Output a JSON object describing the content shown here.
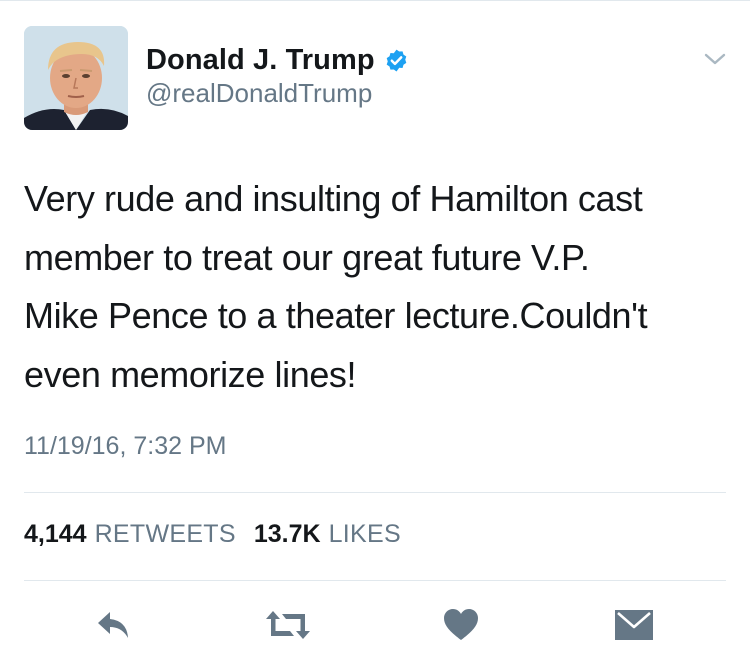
{
  "user": {
    "display_name": "Donald J. Trump",
    "handle": "@realDonaldTrump",
    "verified": true,
    "avatar_icon": "profile-photo"
  },
  "tweet": {
    "text": "Very rude and insulting of Hamilton cast\nmember to treat our great future V.P.\nMike Pence to a theater lecture.Couldn't\neven memorize lines!",
    "timestamp": "11/19/16, 7:32 PM"
  },
  "stats": {
    "retweets_count": "4,144",
    "retweets_label": "RETWEETS",
    "likes_count": "13.7K",
    "likes_label": "LIKES"
  },
  "actions": [
    {
      "icon": "reply-icon"
    },
    {
      "icon": "retweet-icon"
    },
    {
      "icon": "heart-icon"
    },
    {
      "icon": "direct-message-icon"
    }
  ],
  "colors": {
    "primary_text": "#14171a",
    "secondary_text": "#657786",
    "verified_blue": "#1da1f2",
    "action_icon": "#657786",
    "divider": "#e1e8ed"
  }
}
